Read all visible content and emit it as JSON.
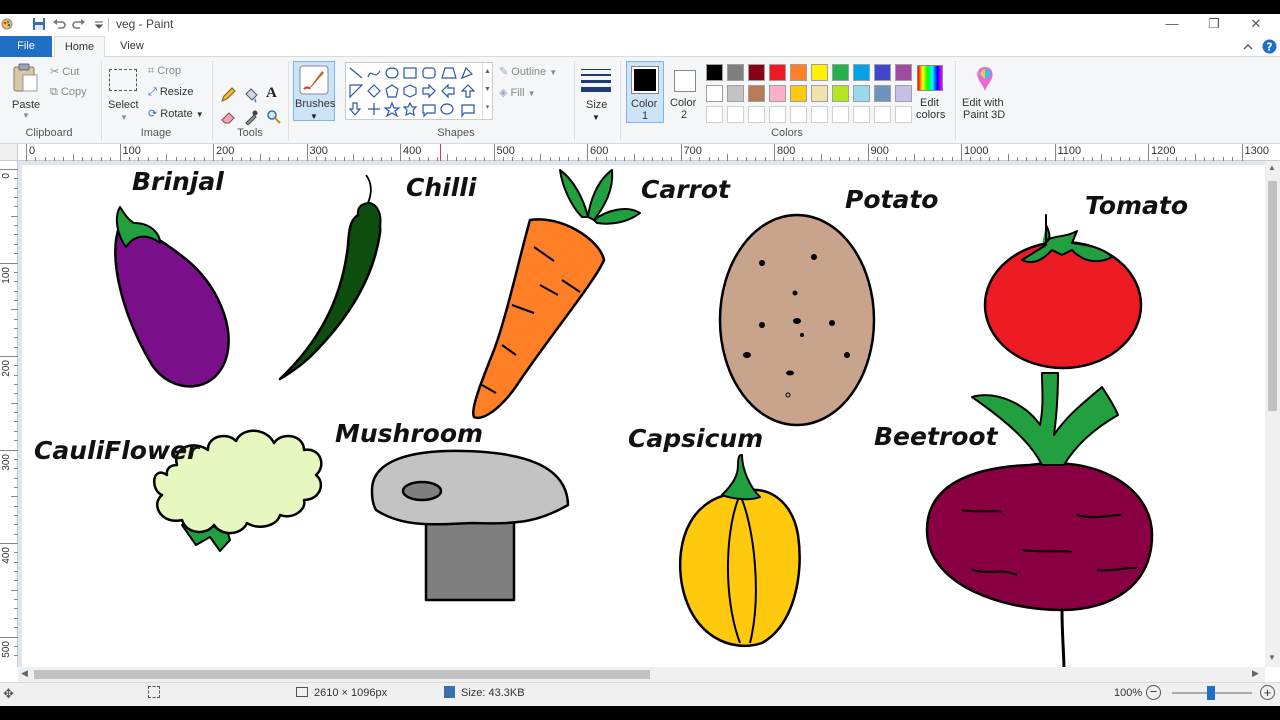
{
  "window": {
    "title": "veg - Paint",
    "minimize": "—",
    "restore": "❐",
    "close": "✕"
  },
  "tabs": {
    "file": "File",
    "home": "Home",
    "view": "View"
  },
  "clipboard": {
    "paste": "Paste",
    "cut": "Cut",
    "copy": "Copy",
    "label": "Clipboard"
  },
  "image": {
    "select": "Select",
    "crop": "Crop",
    "resize": "Resize",
    "rotate": "Rotate",
    "label": "Image"
  },
  "tools": {
    "label": "Tools"
  },
  "brushes": {
    "label": "Brushes"
  },
  "shapes": {
    "outline": "Outline",
    "fill": "Fill",
    "label": "Shapes"
  },
  "size": {
    "label": "Size"
  },
  "colors": {
    "color1": "Color",
    "color1_num": "1",
    "color2": "Color",
    "color2_num": "2",
    "edit_colors_1": "Edit",
    "edit_colors_2": "colors",
    "paint3d_1": "Edit with",
    "paint3d_2": "Paint 3D",
    "label": "Colors",
    "palette_row1": [
      "#000000",
      "#7f7f7f",
      "#880015",
      "#ed1c24",
      "#ff7f27",
      "#fff200",
      "#22b14c",
      "#00a2e8",
      "#3f48cc",
      "#a349a4"
    ],
    "palette_row2": [
      "#ffffff",
      "#c3c3c3",
      "#b97a57",
      "#ffaec9",
      "#ffc90e",
      "#efe4b0",
      "#b5e61d",
      "#99d9ea",
      "#7092be",
      "#c8bfe7"
    ],
    "palette_row3": [
      "#ffffff",
      "#ffffff",
      "#ffffff",
      "#ffffff",
      "#ffffff",
      "#ffffff",
      "#ffffff",
      "#ffffff",
      "#ffffff",
      "#ffffff"
    ]
  },
  "ruler": {
    "h": [
      "0",
      "100",
      "200",
      "300",
      "400",
      "500",
      "600",
      "700",
      "800",
      "900",
      "1000",
      "1100",
      "1200",
      "1300"
    ],
    "v": [
      "0",
      "100",
      "200",
      "300",
      "400",
      "500"
    ]
  },
  "drawing": {
    "brinjal": "Brinjal",
    "chilli": "Chilli",
    "carrot": "Carrot",
    "potato": "Potato",
    "tomato": "Tomato",
    "cauliflower": "CauliFlower",
    "mushroom": "Mushroom",
    "capsicum": "Capsicum",
    "beetroot": "Beetroot"
  },
  "status": {
    "dimensions": "2610 × 1096px",
    "size": "Size: 43.3KB",
    "zoom": "100%"
  }
}
